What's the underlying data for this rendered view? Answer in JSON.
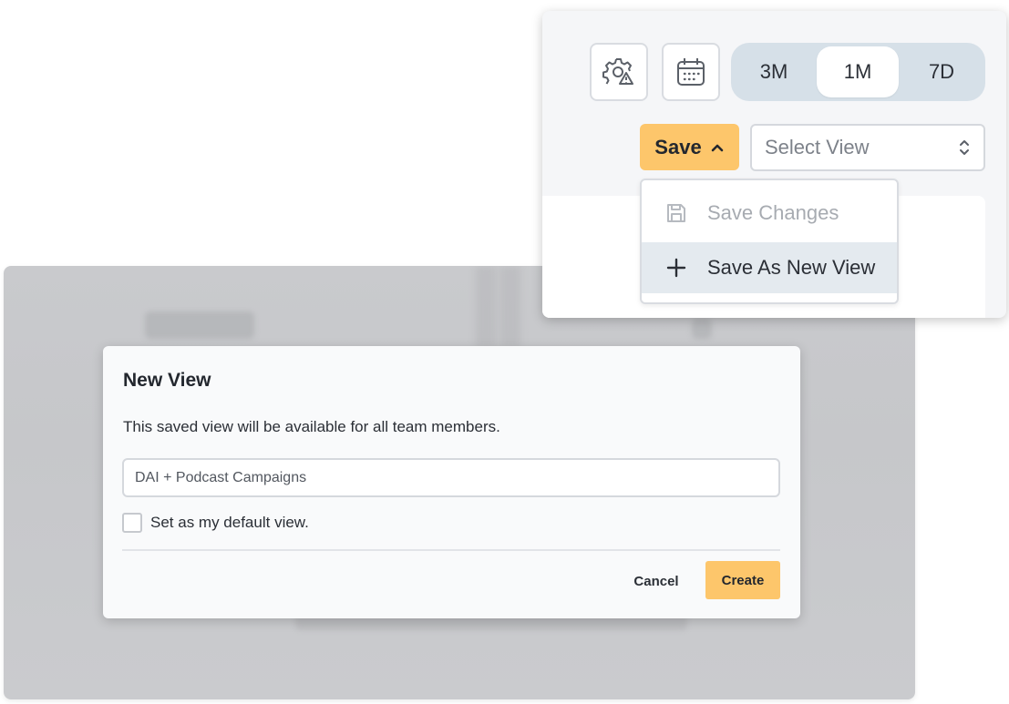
{
  "toolbar": {
    "settings_icon": "settings-warning-icon",
    "calendar_icon": "calendar-icon",
    "range_options": [
      {
        "label": "3M",
        "active": false
      },
      {
        "label": "1M",
        "active": true
      },
      {
        "label": "7D",
        "active": false
      }
    ],
    "save_label": "Save",
    "save_caret_icon": "chevron-up-icon",
    "select_view_placeholder": "Select View",
    "accent_color": "#fdc66b",
    "segment_bg_color": "#d6e0e8"
  },
  "save_menu": {
    "items": [
      {
        "label": "Save Changes",
        "icon": "floppy-disk-icon",
        "disabled": true
      },
      {
        "label": "Save As New View",
        "icon": "plus-icon",
        "disabled": false,
        "hovered": true
      }
    ]
  },
  "modal": {
    "title": "New View",
    "description": "This saved view will be available for all team members.",
    "name_value": "DAI + Podcast Campaigns",
    "default_checkbox_label": "Set as my default view.",
    "default_checked": false,
    "cancel_label": "Cancel",
    "create_label": "Create"
  }
}
